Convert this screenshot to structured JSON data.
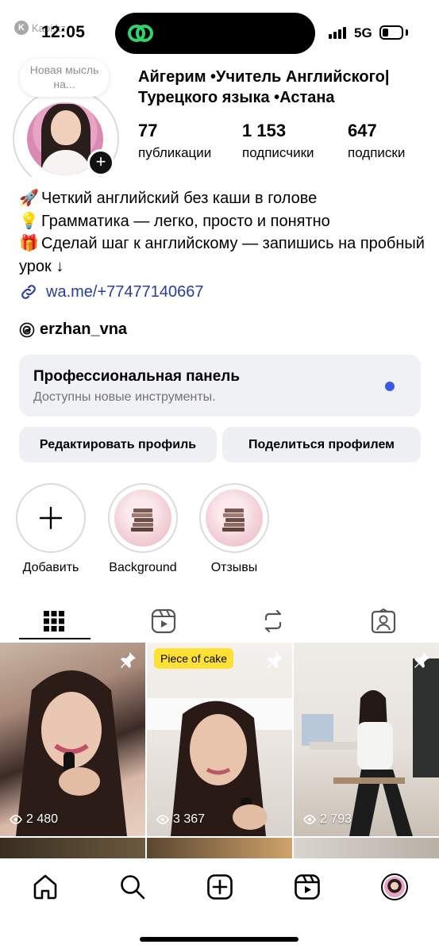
{
  "status_bar": {
    "watermark": "Kapi.kz",
    "time": "12:05",
    "network": "5G",
    "battery_level": 0.34
  },
  "profile": {
    "note": "Новая мысль на...",
    "name": "Айгерим •Учитель Английского| Турецкого языка •Астана",
    "stats": [
      {
        "value": "77",
        "label": "публикации"
      },
      {
        "value": "1 153",
        "label": "подписчики"
      },
      {
        "value": "647",
        "label": "подписки"
      }
    ],
    "bio": [
      {
        "emoji": "🚀",
        "text": "Четкий английский без каши в голове"
      },
      {
        "emoji": "💡",
        "text": "Грамматика — легко, просто и понятно"
      },
      {
        "emoji": "🎁",
        "text": "Сделай шаг к английскому — запишись на пробный урок ↓"
      }
    ],
    "link": "wa.me/+77477140667",
    "threads_handle": "erzhan_vna"
  },
  "pro_panel": {
    "title": "Профессиональная панель",
    "subtitle": "Доступны новые инструменты."
  },
  "buttons": {
    "edit": "Редактировать профиль",
    "share": "Поделиться профилем"
  },
  "highlights": [
    {
      "label": "Добавить",
      "icon": "plus-icon"
    },
    {
      "label": "Background",
      "icon": "books-icon"
    },
    {
      "label": "Отзывы",
      "icon": "books-icon"
    }
  ],
  "tabs": [
    {
      "name": "grid",
      "icon": "grid-icon",
      "active": true
    },
    {
      "name": "reels",
      "icon": "reels-icon",
      "active": false
    },
    {
      "name": "reposts",
      "icon": "repost-icon",
      "active": false
    },
    {
      "name": "tagged",
      "icon": "tagged-icon",
      "active": false
    }
  ],
  "posts": [
    {
      "views": "2 480",
      "pinned": true,
      "tag": ""
    },
    {
      "views": "3 367",
      "pinned": true,
      "tag": "Piece of cake"
    },
    {
      "views": "2 793",
      "pinned": true,
      "tag": ""
    }
  ],
  "bottom_nav": [
    "home-icon",
    "search-icon",
    "create-icon",
    "reels-icon",
    "profile-avatar"
  ]
}
